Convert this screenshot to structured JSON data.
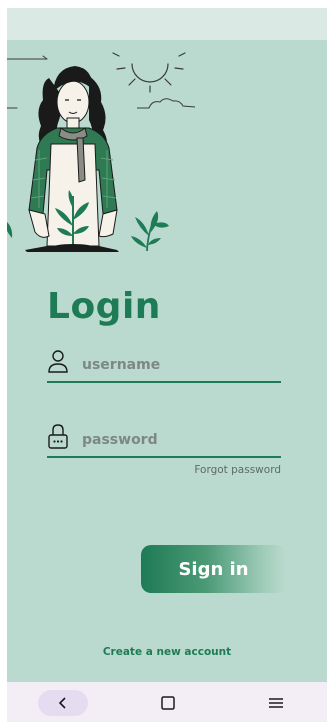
{
  "login": {
    "title": "Login",
    "username_placeholder": "username",
    "password_placeholder": "password",
    "forgot_password": "Forgot password",
    "sign_in": "Sign in",
    "create_account": "Create a new account"
  },
  "icons": {
    "username": "user-icon",
    "password": "lock-icon",
    "nav_back": "chevron-left-icon",
    "nav_home": "square-icon",
    "nav_menu": "menu-icon"
  },
  "colors": {
    "accent": "#1e7b55",
    "background": "#bbdacf",
    "status_bar": "#dbe9e4",
    "nav_bar": "#f3eef6"
  }
}
